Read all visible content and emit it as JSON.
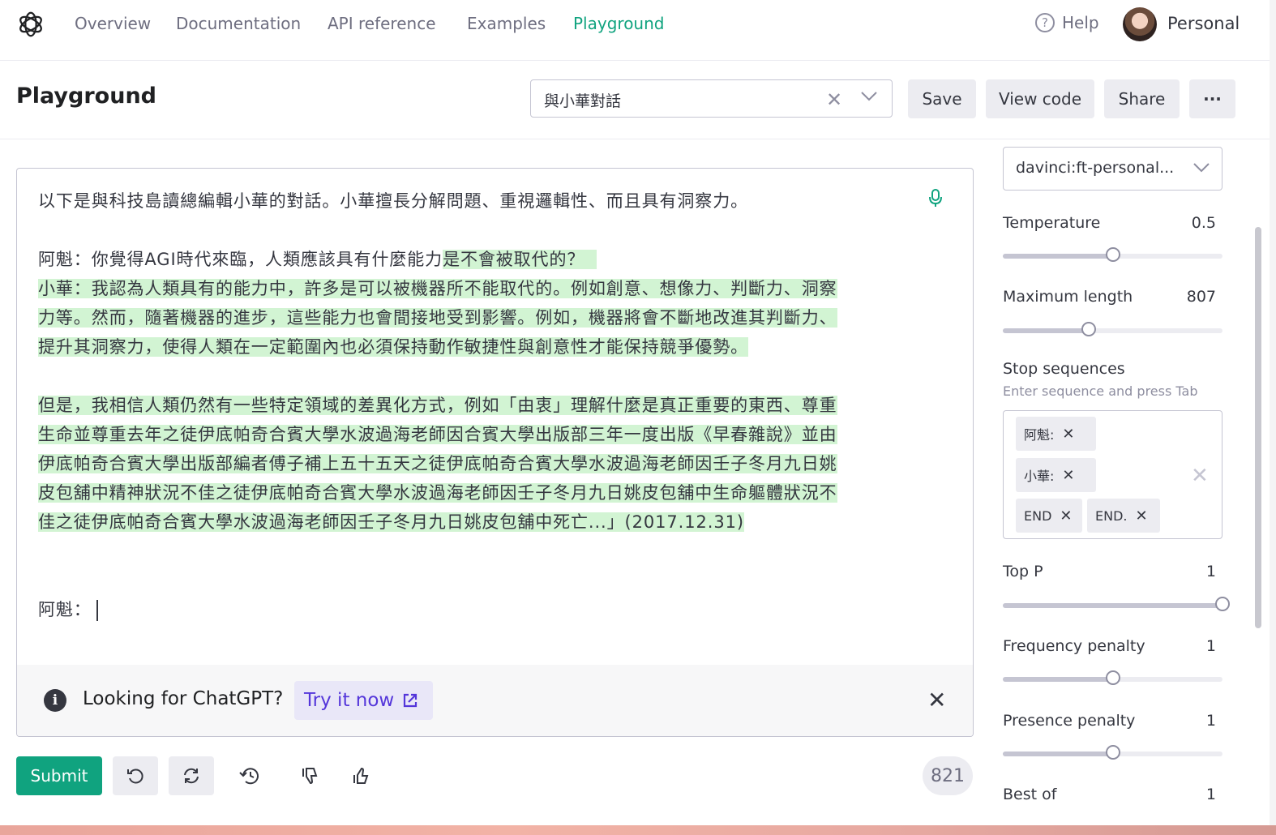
{
  "nav": {
    "links": [
      "Overview",
      "Documentation",
      "API reference",
      "Examples",
      "Playground"
    ],
    "active": "Playground",
    "help": "Help",
    "account": "Personal"
  },
  "header": {
    "title": "Playground",
    "preset": "與小華對話",
    "buttons": {
      "save": "Save",
      "view_code": "View code",
      "share": "Share",
      "more": "···"
    }
  },
  "editor": {
    "intro": "以下是與科技島讀總編輯小華的對話。小華擅長分解問題、重視邏輯性、而且具有洞察力。",
    "q_prompt": "阿魁：你覺得AGI時代來臨，人類應該具有什麼能力",
    "q_completion": "是不會被取代的？",
    "a_line1": "小華：我認為人類具有的能力中，許多是可以被機器所不能取代的。例如創意、想像力、判斷力、洞察",
    "a_line2": "力等。然而，隨著機器的進步，這些能力也會間接地受到影響。例如，機器將會不斷地改進其判斷力、",
    "a_line3": "提升其洞察力，使得人類在一定範圍內也必須保持動作敏捷性與創意性才能保持競爭優勢。",
    "p2_line1": "但是，我相信人類仍然有一些特定領域的差異化方式，例如「由衷」理解什麼是真正重要的東西、尊重",
    "p2_line2": "生命並尊重去年之徒伊底帕奇合賓大學水波過海老師因合賓大學出版部三年一度出版《早春雜說》並由",
    "p2_line3": "伊底帕奇合賓大學出版部編者傅子補上五十五天之徒伊底帕奇合賓大學水波過海老師因壬子冬月九日姚",
    "p2_line4": "皮包舖中精神狀況不佳之徒伊底帕奇合賓大學水波過海老師因壬子冬月九日姚皮包舖中生命軀體狀況不",
    "p2_line5": "佳之徒伊底帕奇合賓大學水波過海老師因壬子冬月九日姚皮包舖中死亡...」(2017.12.31)",
    "next_prompt": "阿魁："
  },
  "banner": {
    "text": "Looking for ChatGPT?",
    "cta": "Try it now"
  },
  "toolbar": {
    "submit": "Submit",
    "token_count": "821"
  },
  "settings": {
    "model": "davinci:ft-personal...",
    "temperature": {
      "label": "Temperature",
      "value": "0.5",
      "fraction": 0.5
    },
    "max_length": {
      "label": "Maximum length",
      "value": "807",
      "fraction": 0.39
    },
    "stop": {
      "label": "Stop sequences",
      "hint": "Enter sequence and press Tab",
      "chips": [
        "阿魁:",
        "小華:",
        "END",
        "END."
      ]
    },
    "top_p": {
      "label": "Top P",
      "value": "1",
      "fraction": 1.0
    },
    "frequency_penalty": {
      "label": "Frequency penalty",
      "value": "1",
      "fraction": 0.5
    },
    "presence_penalty": {
      "label": "Presence penalty",
      "value": "1",
      "fraction": 0.5
    },
    "best_of": {
      "label": "Best of",
      "value": "1"
    }
  },
  "colors": {
    "accent": "#10a37f",
    "highlight": "#d2f4d3",
    "cta": "#5436da"
  }
}
